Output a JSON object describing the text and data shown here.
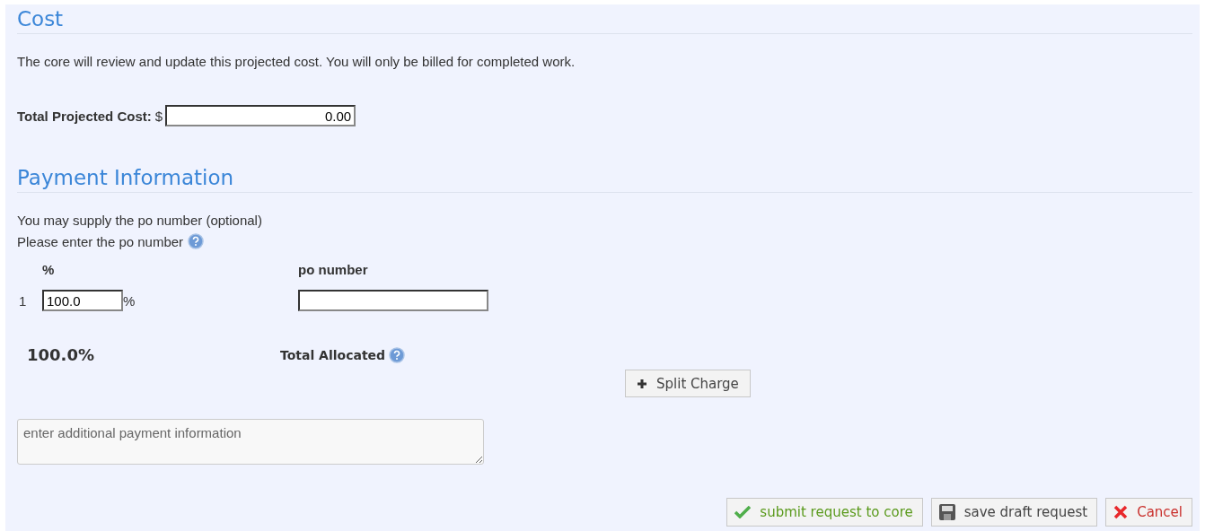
{
  "cost": {
    "heading": "Cost",
    "note": "The core will review and update this projected cost. You will only be billed for completed work.",
    "total_label": "Total Projected Cost:",
    "currency": "$",
    "total_value": "0.00"
  },
  "payment": {
    "heading": "Payment Information",
    "lines": [
      "You may supply the po number (optional)",
      "Please enter the po number"
    ],
    "columns": [
      "%",
      "po number"
    ],
    "rows": [
      {
        "index": "1",
        "percent": "100.0",
        "percent_unit": "%",
        "po_number": ""
      }
    ],
    "total_percent": "100.0%",
    "total_label": "Total Allocated",
    "split_button": "Split Charge",
    "notes_placeholder": "enter additional payment information"
  },
  "actions": [
    {
      "kind": "submit",
      "label": "submit request to core"
    },
    {
      "kind": "save",
      "label": "save draft request"
    },
    {
      "kind": "cancel",
      "label": "Cancel"
    }
  ]
}
